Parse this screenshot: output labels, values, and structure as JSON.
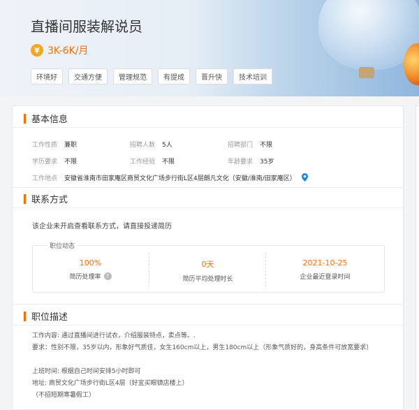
{
  "header": {
    "title": "直播间服装解说员",
    "salary": "3K-6K/月",
    "salary_icon": "¥",
    "tags": [
      "环境好",
      "交通方便",
      "管理规范",
      "有提成",
      "晋升快",
      "技术培训"
    ]
  },
  "basic_info": {
    "section_title": "基本信息",
    "rows": [
      [
        {
          "label": "工作性质",
          "value": "兼职"
        },
        {
          "label": "招聘人数",
          "value": "5人"
        },
        {
          "label": "招聘部门",
          "value": "不限"
        }
      ],
      [
        {
          "label": "学历要求",
          "value": "不限"
        },
        {
          "label": "工作经验",
          "value": "不限"
        },
        {
          "label": "年龄要求",
          "value": "35岁"
        }
      ]
    ],
    "address_label": "工作地点",
    "address_value": "安徽省淮南市田家庵区商贸文化广场步行街L区4层朗凡文化（安徽/淮南/田家庵区）"
  },
  "contact": {
    "section_title": "联系方式",
    "notice": "该企业未开启查看联系方式，请直接投递简历",
    "stats_label": "职位动态",
    "stats": [
      {
        "value": "100%",
        "desc": "简历处理率"
      },
      {
        "value": "0天",
        "desc": "简历平均处理时长"
      },
      {
        "value": "2021-10-25",
        "desc": "企业最近登录时间"
      }
    ],
    "help_glyph": "?"
  },
  "description": {
    "section_title": "职位描述",
    "lines": [
      "工作内容: 通过直播间进行试衣，介绍服装特点，卖点等。.",
      "要求：性别不限，35岁以内，形象好气质佳，女生160cm以上，男生180cm以上（形象气质好的，身高条件可放宽要求）",
      "",
      "上班时间: 根据自己时间安排5小时即可",
      "地址: 商贸文化广场步行街L区4层（好宜买眼镜店楼上）",
      "（不招短期寒暑假工）"
    ]
  },
  "colors": {
    "accent": "#ff6d00",
    "tag_border": "#dddddd"
  }
}
